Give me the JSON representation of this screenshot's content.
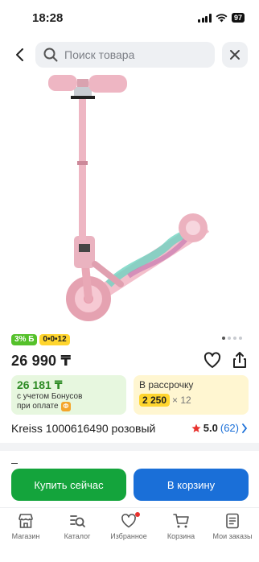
{
  "status_bar": {
    "time": "18:28",
    "battery": "97"
  },
  "search": {
    "placeholder": "Поиск товара"
  },
  "product": {
    "image_icon": "pink-kick-scooter",
    "badges": {
      "bonus": "3% Б",
      "installment": "0•0•12"
    },
    "price": "26 990 ₸",
    "bonus_card": {
      "value": "26 181 ₸",
      "line1": "с учетом Бонусов",
      "line2": "при оплате",
      "badge": "Ф"
    },
    "installment_card": {
      "label": "В рассрочку",
      "amount": "2 250",
      "months": "× 12"
    },
    "title": "Kreiss 1000616490 розовый",
    "rating": {
      "value": "5.0",
      "count": "(62)"
    },
    "gallery": {
      "total": 4,
      "active": 0
    }
  },
  "actions": {
    "buy_now": "Купить сейчас",
    "add_to_cart": "В корзину"
  },
  "tabs": [
    {
      "label": "Магазин",
      "icon": "store-icon"
    },
    {
      "label": "Каталог",
      "icon": "catalog-search-icon"
    },
    {
      "label": "Избранное",
      "icon": "heart-icon"
    },
    {
      "label": "Корзина",
      "icon": "cart-icon"
    },
    {
      "label": "Мои заказы",
      "icon": "orders-icon"
    }
  ],
  "colors": {
    "buy_button": "#14a43c",
    "cart_button": "#1a6fd8",
    "bonus_green": "#55c12b",
    "installment_yellow": "#ffd52e",
    "product_pink": "#f0b7c3"
  }
}
